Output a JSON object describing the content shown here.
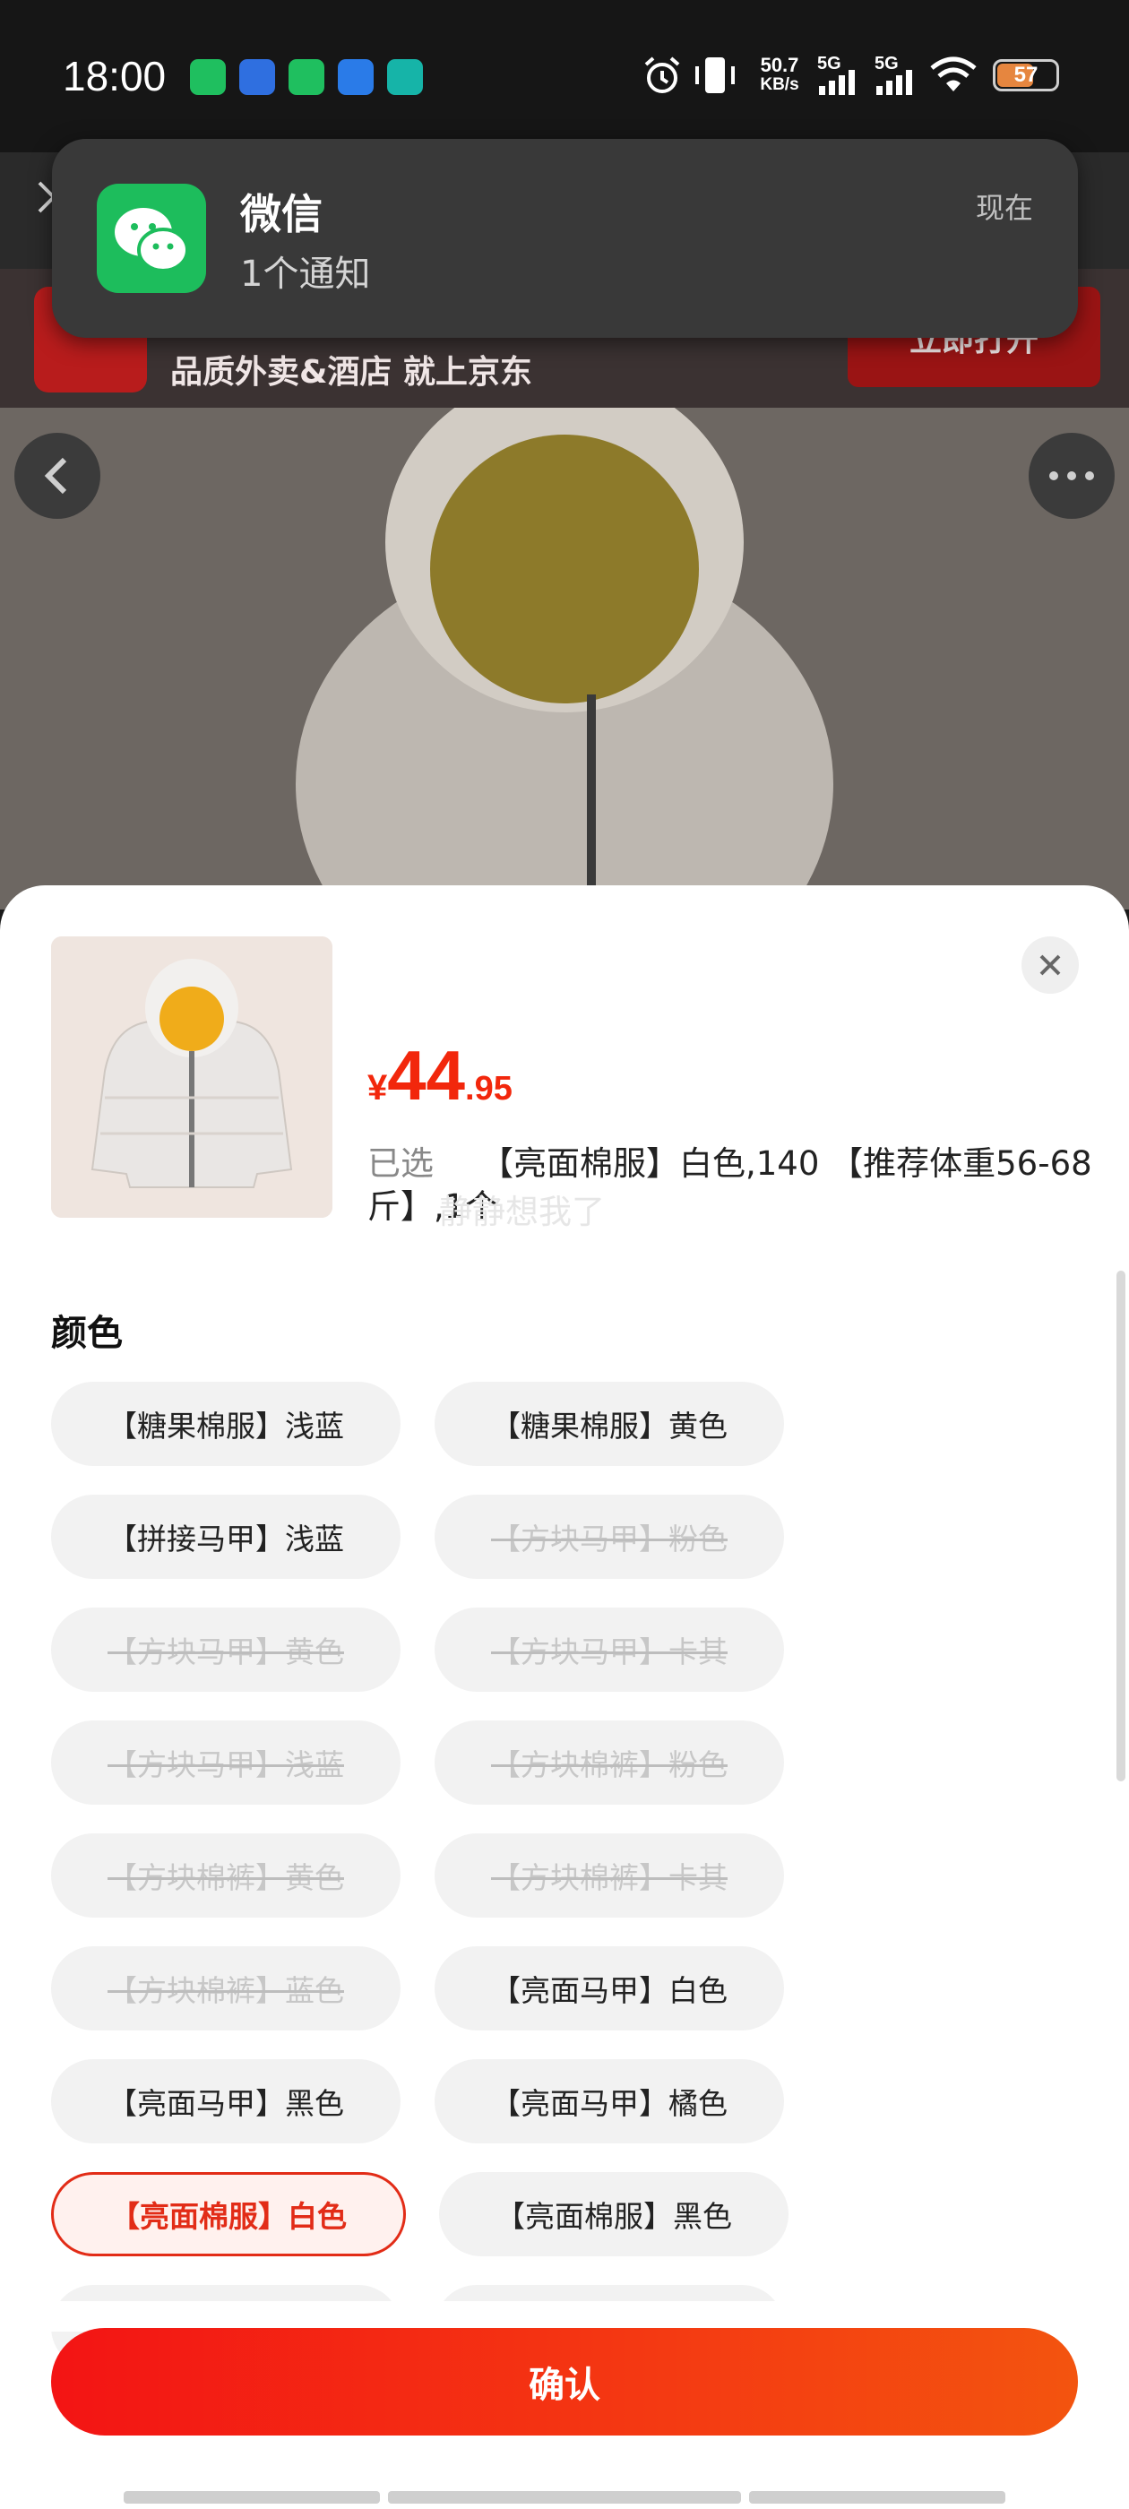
{
  "status_bar": {
    "time": "18:00",
    "net_speed": "50.7",
    "net_unit": "KB/s",
    "sig1": "5G",
    "sig2": "5G",
    "battery": "57",
    "app_icons": [
      "wechat-icon",
      "k-app-icon",
      "wechat-icon",
      "eyes-app-icon",
      "boss-app-icon"
    ]
  },
  "page_behind": {
    "ad_text": "品质外卖&酒店 就上京东",
    "ad_button": "立即打开"
  },
  "notification": {
    "app": "微信",
    "message": "1个通知",
    "time": "现在"
  },
  "sheet": {
    "price_symbol": "¥",
    "price_int": "44",
    "price_dec": ".95",
    "selected_label": "已选",
    "selected_value": "【亮面棉服】白色,140 【推荐体重56-68斤】,1个",
    "overlay_text": "静静想我了",
    "section_title": "颜色",
    "options": [
      {
        "label": "【糖果棉服】浅蓝",
        "state": "normal"
      },
      {
        "label": "【糖果棉服】黄色",
        "state": "normal"
      },
      {
        "label": "【拼接马甲】浅蓝",
        "state": "normal"
      },
      {
        "label": "【方块马甲】粉色",
        "state": "disabled"
      },
      {
        "label": "【方块马甲】黄色",
        "state": "disabled"
      },
      {
        "label": "【方块马甲】卡其",
        "state": "disabled"
      },
      {
        "label": "【方块马甲】浅蓝",
        "state": "disabled"
      },
      {
        "label": "【方块棉裤】粉色",
        "state": "disabled"
      },
      {
        "label": "【方块棉裤】黄色",
        "state": "disabled"
      },
      {
        "label": "【方块棉裤】卡其",
        "state": "disabled"
      },
      {
        "label": "【方块棉裤】蓝色",
        "state": "disabled"
      },
      {
        "label": "【亮面马甲】白色",
        "state": "normal"
      },
      {
        "label": "【亮面马甲】黑色",
        "state": "normal"
      },
      {
        "label": "【亮面马甲】橘色",
        "state": "normal"
      },
      {
        "label": "【亮面棉服】白色",
        "state": "active"
      },
      {
        "label": "【亮面棉服】黑色",
        "state": "normal"
      }
    ],
    "confirm_label": "确认"
  },
  "colors": {
    "accent": "#f2270c",
    "wechat_green": "#1dbd5c"
  }
}
